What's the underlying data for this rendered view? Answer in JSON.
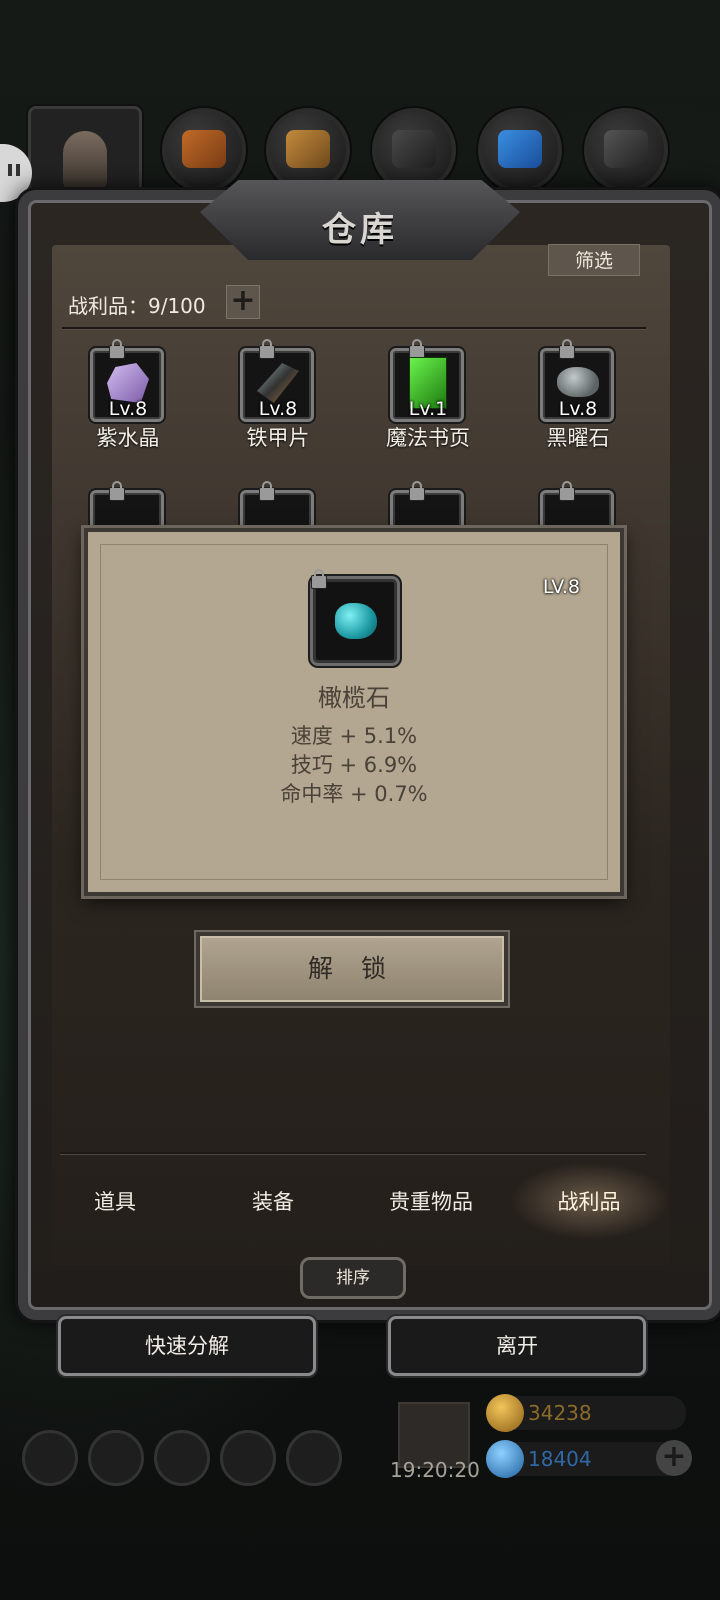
{
  "header": {
    "title": "仓库",
    "filter_label": "筛选"
  },
  "loot": {
    "count_label": "战利品：9/100",
    "add_label": "+"
  },
  "items_row1": [
    {
      "level": "Lv.8",
      "name": "紫水晶",
      "icon": "amethyst-icon",
      "color": "#9a78c9"
    },
    {
      "level": "Lv.8",
      "name": "铁甲片",
      "icon": "iron-plate-icon",
      "color": "#5a5a5e"
    },
    {
      "level": "Lv.1",
      "name": "魔法书页",
      "icon": "spell-page-icon",
      "color": "#3fbf2a"
    },
    {
      "level": "Lv.8",
      "name": "黑曜石",
      "icon": "obsidian-icon",
      "color": "#8c9293"
    }
  ],
  "detail": {
    "level": "LV.8",
    "name": "橄榄石",
    "icon": "olivine-icon",
    "stats": [
      "速度 + 5.1%",
      "技巧 + 6.9%",
      "命中率 + 0.7%"
    ]
  },
  "unlock_label": "解 锁",
  "tabs": [
    {
      "label": "道具"
    },
    {
      "label": "装备"
    },
    {
      "label": "贵重物品"
    },
    {
      "label": "战利品",
      "active": true
    }
  ],
  "sort_label": "排序",
  "quick_decompose_label": "快速分解",
  "leave_label": "离开",
  "hud": {
    "clock": "19:20:20",
    "gold": "34238",
    "gems": "18404",
    "plus": "+"
  }
}
